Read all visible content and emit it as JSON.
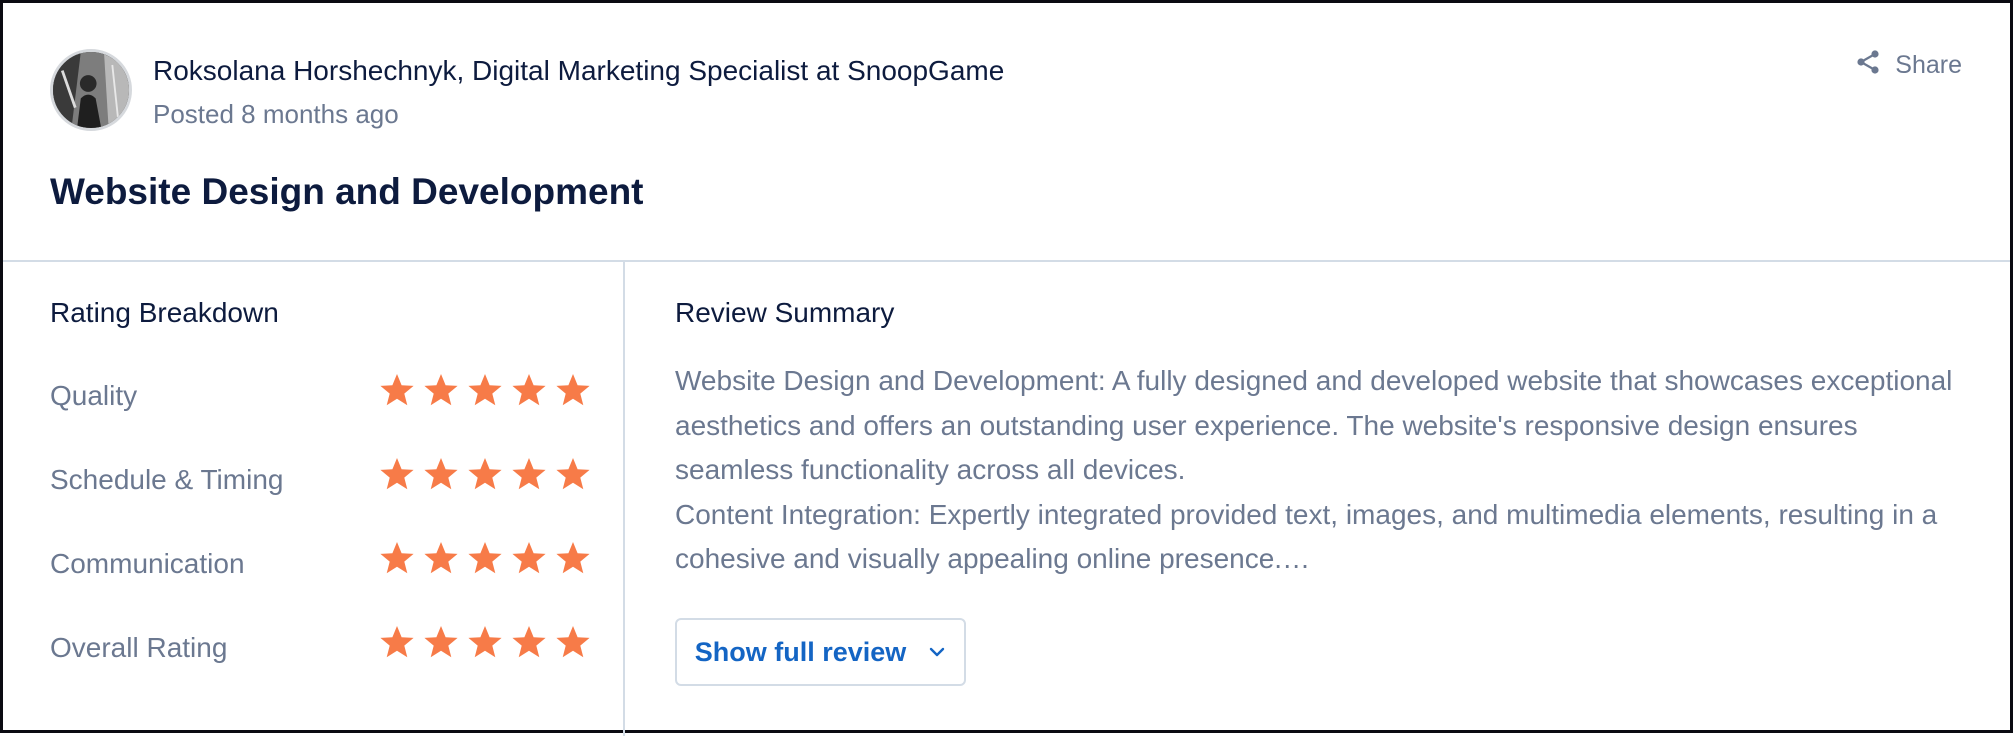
{
  "review": {
    "author": "Roksolana Horshechnyk, Digital Marketing Specialist at SnoopGame",
    "posted": "Posted 8 months ago",
    "share_label": "Share",
    "title": "Website Design and Development"
  },
  "rating_breakdown": {
    "heading": "Rating Breakdown",
    "max_stars": 5,
    "star_color": "#f77b48",
    "items": [
      {
        "label": "Quality",
        "stars": 5
      },
      {
        "label": "Schedule & Timing",
        "stars": 5
      },
      {
        "label": "Communication",
        "stars": 5
      },
      {
        "label": "Overall Rating",
        "stars": 5
      }
    ]
  },
  "review_summary": {
    "heading": "Review Summary",
    "paragraph_1": "Website Design and Development: A fully designed and developed website that showcases exceptional aesthetics and offers an outstanding user experience. The website's responsive design ensures seamless functionality across all devices.",
    "paragraph_2": "Content Integration: Expertly integrated provided text, images, and multimedia elements, resulting in a cohesive and visually appealing online presence.…",
    "show_full_label": "Show full review"
  },
  "colors": {
    "heading": "#0d1b3e",
    "muted_text": "#6b7890",
    "link": "#1465c4",
    "divider": "#d3dce6"
  },
  "icons": {
    "share": "share-icon",
    "chevron": "chevron-down-icon",
    "star": "star-icon"
  }
}
